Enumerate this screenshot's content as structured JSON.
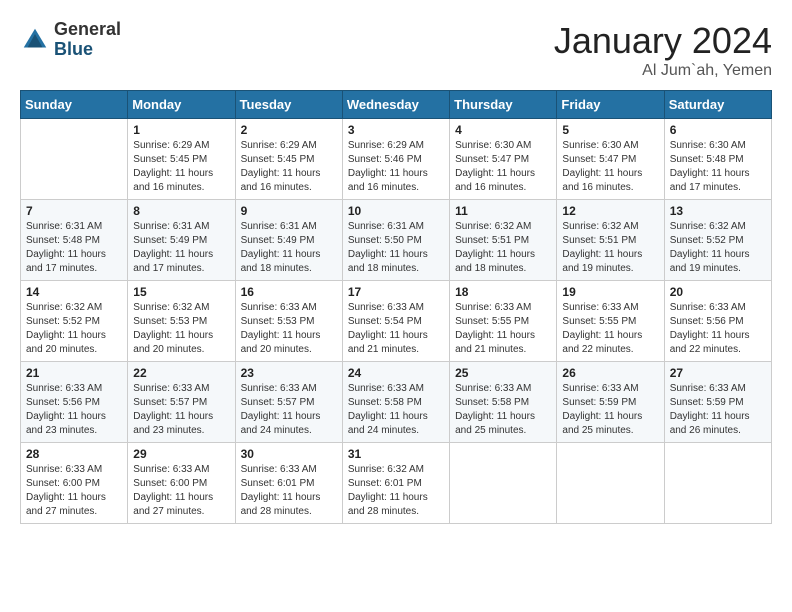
{
  "header": {
    "logo_general": "General",
    "logo_blue": "Blue",
    "month_title": "January 2024",
    "location": "Al Jum`ah, Yemen"
  },
  "days_of_week": [
    "Sunday",
    "Monday",
    "Tuesday",
    "Wednesday",
    "Thursday",
    "Friday",
    "Saturday"
  ],
  "weeks": [
    [
      {
        "day": "",
        "sunrise": "",
        "sunset": "",
        "daylight": ""
      },
      {
        "day": "1",
        "sunrise": "Sunrise: 6:29 AM",
        "sunset": "Sunset: 5:45 PM",
        "daylight": "Daylight: 11 hours and 16 minutes."
      },
      {
        "day": "2",
        "sunrise": "Sunrise: 6:29 AM",
        "sunset": "Sunset: 5:45 PM",
        "daylight": "Daylight: 11 hours and 16 minutes."
      },
      {
        "day": "3",
        "sunrise": "Sunrise: 6:29 AM",
        "sunset": "Sunset: 5:46 PM",
        "daylight": "Daylight: 11 hours and 16 minutes."
      },
      {
        "day": "4",
        "sunrise": "Sunrise: 6:30 AM",
        "sunset": "Sunset: 5:47 PM",
        "daylight": "Daylight: 11 hours and 16 minutes."
      },
      {
        "day": "5",
        "sunrise": "Sunrise: 6:30 AM",
        "sunset": "Sunset: 5:47 PM",
        "daylight": "Daylight: 11 hours and 16 minutes."
      },
      {
        "day": "6",
        "sunrise": "Sunrise: 6:30 AM",
        "sunset": "Sunset: 5:48 PM",
        "daylight": "Daylight: 11 hours and 17 minutes."
      }
    ],
    [
      {
        "day": "7",
        "sunrise": "Sunrise: 6:31 AM",
        "sunset": "Sunset: 5:48 PM",
        "daylight": "Daylight: 11 hours and 17 minutes."
      },
      {
        "day": "8",
        "sunrise": "Sunrise: 6:31 AM",
        "sunset": "Sunset: 5:49 PM",
        "daylight": "Daylight: 11 hours and 17 minutes."
      },
      {
        "day": "9",
        "sunrise": "Sunrise: 6:31 AM",
        "sunset": "Sunset: 5:49 PM",
        "daylight": "Daylight: 11 hours and 18 minutes."
      },
      {
        "day": "10",
        "sunrise": "Sunrise: 6:31 AM",
        "sunset": "Sunset: 5:50 PM",
        "daylight": "Daylight: 11 hours and 18 minutes."
      },
      {
        "day": "11",
        "sunrise": "Sunrise: 6:32 AM",
        "sunset": "Sunset: 5:51 PM",
        "daylight": "Daylight: 11 hours and 18 minutes."
      },
      {
        "day": "12",
        "sunrise": "Sunrise: 6:32 AM",
        "sunset": "Sunset: 5:51 PM",
        "daylight": "Daylight: 11 hours and 19 minutes."
      },
      {
        "day": "13",
        "sunrise": "Sunrise: 6:32 AM",
        "sunset": "Sunset: 5:52 PM",
        "daylight": "Daylight: 11 hours and 19 minutes."
      }
    ],
    [
      {
        "day": "14",
        "sunrise": "Sunrise: 6:32 AM",
        "sunset": "Sunset: 5:52 PM",
        "daylight": "Daylight: 11 hours and 20 minutes."
      },
      {
        "day": "15",
        "sunrise": "Sunrise: 6:32 AM",
        "sunset": "Sunset: 5:53 PM",
        "daylight": "Daylight: 11 hours and 20 minutes."
      },
      {
        "day": "16",
        "sunrise": "Sunrise: 6:33 AM",
        "sunset": "Sunset: 5:53 PM",
        "daylight": "Daylight: 11 hours and 20 minutes."
      },
      {
        "day": "17",
        "sunrise": "Sunrise: 6:33 AM",
        "sunset": "Sunset: 5:54 PM",
        "daylight": "Daylight: 11 hours and 21 minutes."
      },
      {
        "day": "18",
        "sunrise": "Sunrise: 6:33 AM",
        "sunset": "Sunset: 5:55 PM",
        "daylight": "Daylight: 11 hours and 21 minutes."
      },
      {
        "day": "19",
        "sunrise": "Sunrise: 6:33 AM",
        "sunset": "Sunset: 5:55 PM",
        "daylight": "Daylight: 11 hours and 22 minutes."
      },
      {
        "day": "20",
        "sunrise": "Sunrise: 6:33 AM",
        "sunset": "Sunset: 5:56 PM",
        "daylight": "Daylight: 11 hours and 22 minutes."
      }
    ],
    [
      {
        "day": "21",
        "sunrise": "Sunrise: 6:33 AM",
        "sunset": "Sunset: 5:56 PM",
        "daylight": "Daylight: 11 hours and 23 minutes."
      },
      {
        "day": "22",
        "sunrise": "Sunrise: 6:33 AM",
        "sunset": "Sunset: 5:57 PM",
        "daylight": "Daylight: 11 hours and 23 minutes."
      },
      {
        "day": "23",
        "sunrise": "Sunrise: 6:33 AM",
        "sunset": "Sunset: 5:57 PM",
        "daylight": "Daylight: 11 hours and 24 minutes."
      },
      {
        "day": "24",
        "sunrise": "Sunrise: 6:33 AM",
        "sunset": "Sunset: 5:58 PM",
        "daylight": "Daylight: 11 hours and 24 minutes."
      },
      {
        "day": "25",
        "sunrise": "Sunrise: 6:33 AM",
        "sunset": "Sunset: 5:58 PM",
        "daylight": "Daylight: 11 hours and 25 minutes."
      },
      {
        "day": "26",
        "sunrise": "Sunrise: 6:33 AM",
        "sunset": "Sunset: 5:59 PM",
        "daylight": "Daylight: 11 hours and 25 minutes."
      },
      {
        "day": "27",
        "sunrise": "Sunrise: 6:33 AM",
        "sunset": "Sunset: 5:59 PM",
        "daylight": "Daylight: 11 hours and 26 minutes."
      }
    ],
    [
      {
        "day": "28",
        "sunrise": "Sunrise: 6:33 AM",
        "sunset": "Sunset: 6:00 PM",
        "daylight": "Daylight: 11 hours and 27 minutes."
      },
      {
        "day": "29",
        "sunrise": "Sunrise: 6:33 AM",
        "sunset": "Sunset: 6:00 PM",
        "daylight": "Daylight: 11 hours and 27 minutes."
      },
      {
        "day": "30",
        "sunrise": "Sunrise: 6:33 AM",
        "sunset": "Sunset: 6:01 PM",
        "daylight": "Daylight: 11 hours and 28 minutes."
      },
      {
        "day": "31",
        "sunrise": "Sunrise: 6:32 AM",
        "sunset": "Sunset: 6:01 PM",
        "daylight": "Daylight: 11 hours and 28 minutes."
      },
      {
        "day": "",
        "sunrise": "",
        "sunset": "",
        "daylight": ""
      },
      {
        "day": "",
        "sunrise": "",
        "sunset": "",
        "daylight": ""
      },
      {
        "day": "",
        "sunrise": "",
        "sunset": "",
        "daylight": ""
      }
    ]
  ]
}
